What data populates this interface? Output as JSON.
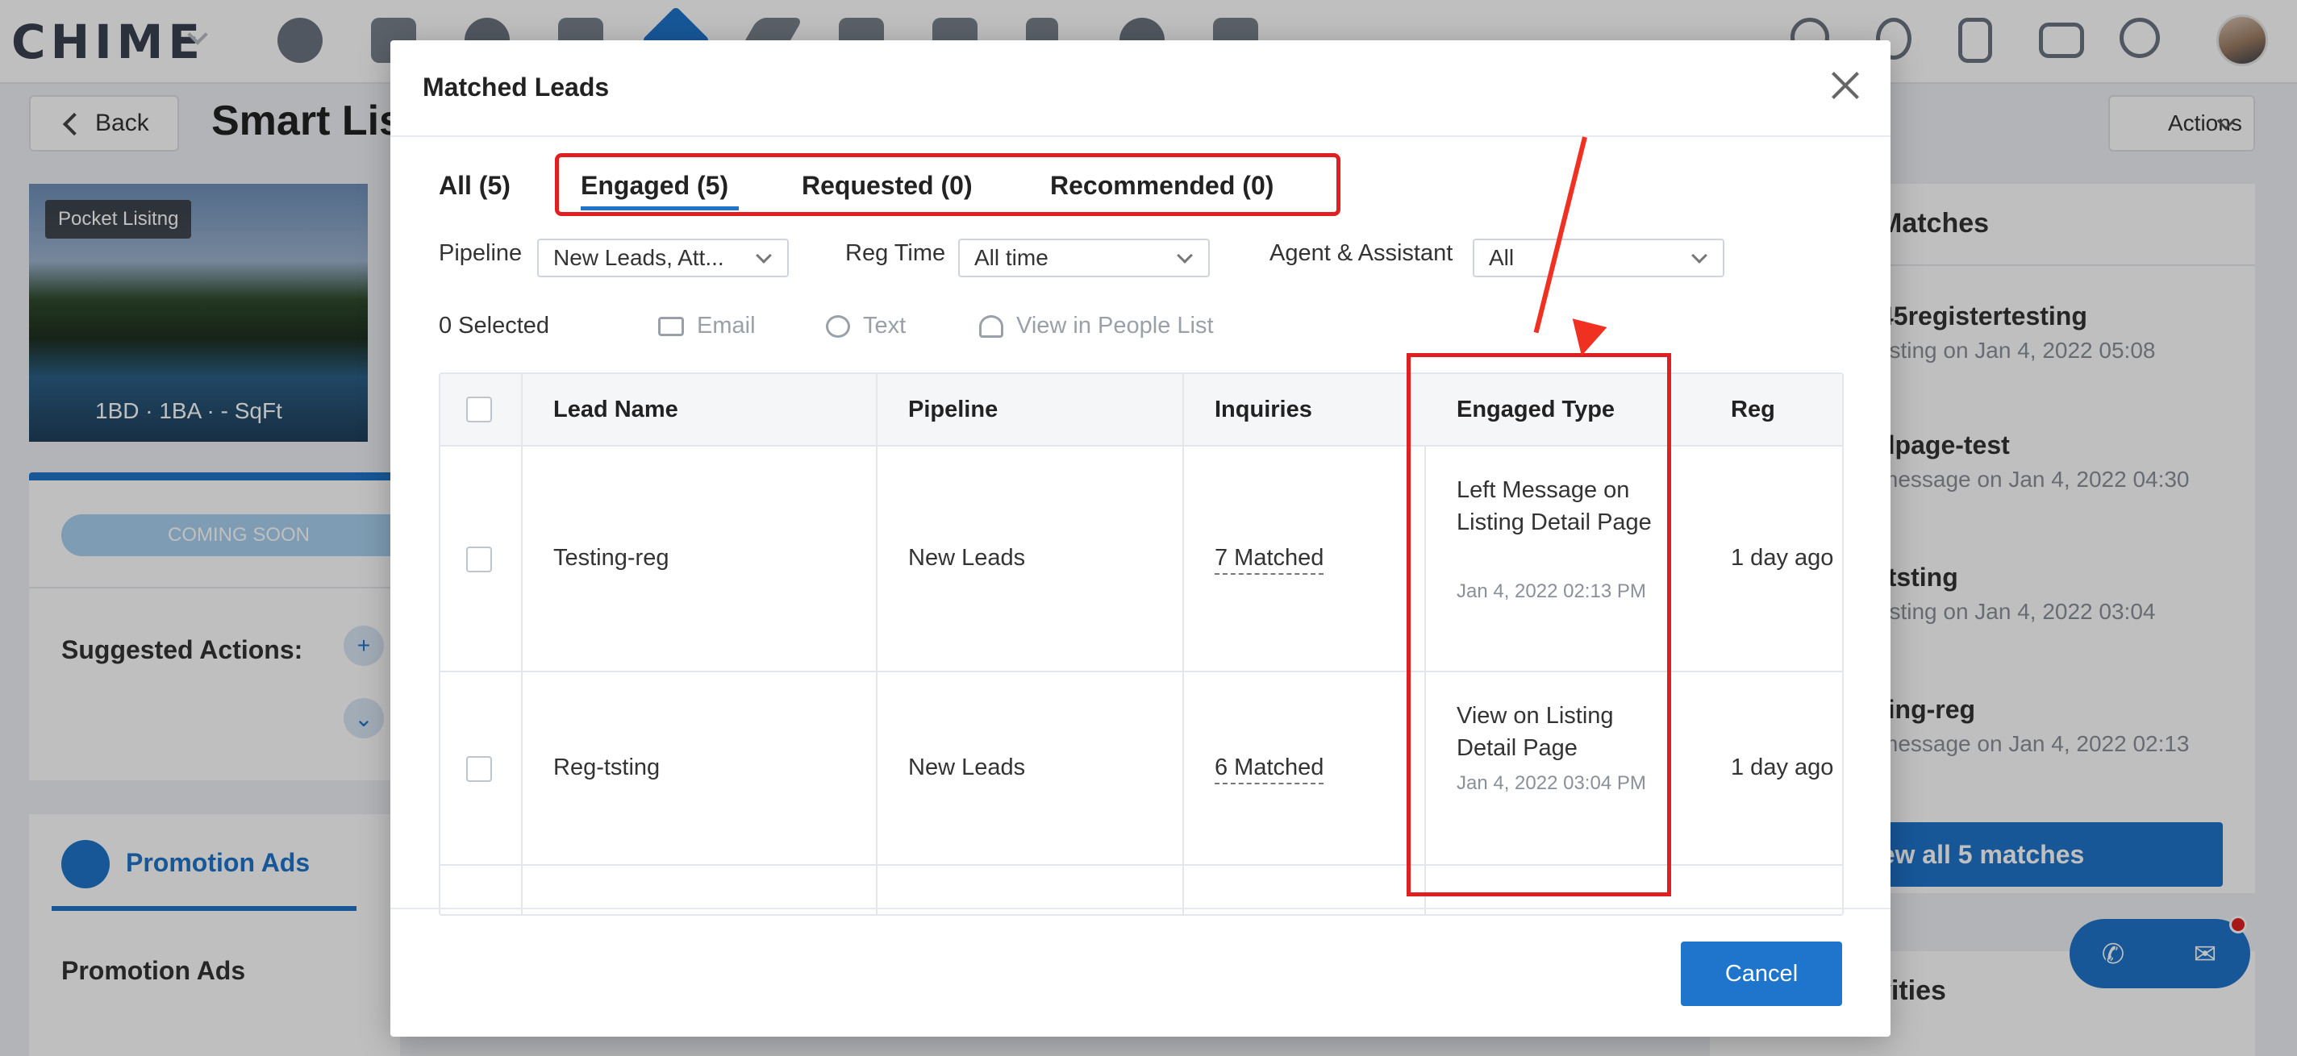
{
  "app": {
    "logo": "CHIME",
    "nav_icons": [
      "lead-icon",
      "people-icon",
      "dollar-icon",
      "briefcase-icon",
      "home-icon",
      "send-icon",
      "grid-icon",
      "video-icon",
      "chart-icon",
      "gear-icon",
      "store-icon"
    ],
    "right_icons": [
      "search-icon",
      "bell-icon",
      "clipboard-icon",
      "message-icon",
      "help-icon"
    ]
  },
  "page": {
    "back_label": "Back",
    "title": "Smart Lis",
    "actions_label": "Actions",
    "listing": {
      "badge": "Pocket Lisitng",
      "meta": "1BD ·  1BA ·  - SqFt"
    },
    "status_pill": "COMING SOON",
    "suggested_actions": "Suggested Actions:",
    "promo_tab": "Promotion Ads",
    "promo_heading": "Promotion Ads",
    "matches_title": "Matches",
    "matches": [
      {
        "name": "45registertesting",
        "sub": " listing on Jan 4, 2022 05:08"
      },
      {
        "name": "dpage-test",
        "sub": "message on Jan 4, 2022 04:30"
      },
      {
        "name": "-tsting",
        "sub": " listing on Jan 4, 2022 03:04"
      },
      {
        "name": "ting-reg",
        "sub": "message on Jan 4, 2022 02:13"
      }
    ],
    "view_all": "ew all 5 matches",
    "activities_title": "vities"
  },
  "modal": {
    "title": "Matched Leads",
    "tabs": [
      {
        "label": "All (5)"
      },
      {
        "label": "Engaged (5)"
      },
      {
        "label": "Requested (0)"
      },
      {
        "label": "Recommended (0)"
      }
    ],
    "filters": {
      "pipeline_label": "Pipeline",
      "pipeline_value": "New Leads, Att...",
      "reg_time_label": "Reg Time",
      "reg_time_value": "All time",
      "agent_label": "Agent & Assistant",
      "agent_value": "All"
    },
    "selected": "0 Selected",
    "bulk": {
      "email": "Email",
      "text": "Text",
      "people": "View in People List"
    },
    "columns": {
      "lead_name": "Lead Name",
      "pipeline": "Pipeline",
      "inquiries": "Inquiries",
      "engaged_type": "Engaged Type",
      "reg": "Reg"
    },
    "rows": [
      {
        "name": "Testing-reg",
        "pipeline": "New Leads",
        "inquiries": "7 Matched",
        "engaged_type": "Left Message on Listing Detail Page",
        "engaged_date": "Jan 4, 2022 02:13 PM",
        "reg": "1 day ago"
      },
      {
        "name": "Reg-tsting",
        "pipeline": "New Leads",
        "inquiries": "6 Matched",
        "engaged_type": "View on Listing Detail Page",
        "engaged_date": "Jan 4, 2022 03:04 PM",
        "reg": "1 day ago"
      }
    ],
    "cancel_label": "Cancel"
  },
  "colors": {
    "accent": "#1f75cb",
    "highlight": "#e02020"
  }
}
